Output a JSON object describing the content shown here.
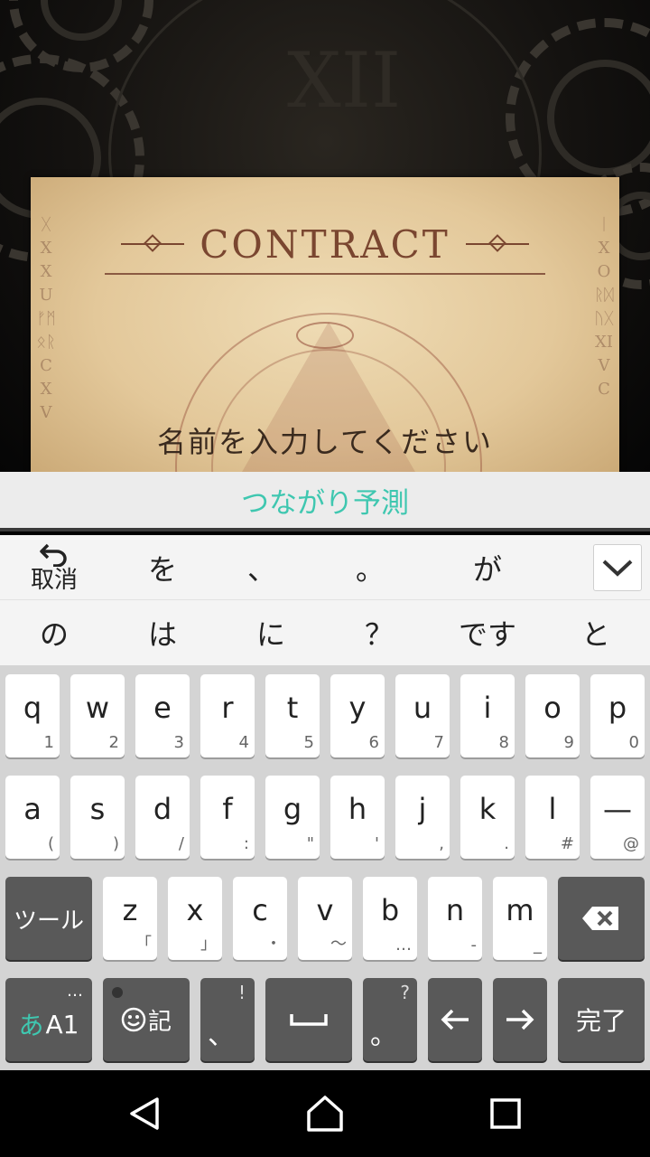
{
  "scene": {
    "numeral": "XII",
    "contract_title": "CONTRACT",
    "prompt": "名前を入力してください"
  },
  "prediction": {
    "label": "つながり予測"
  },
  "candidates": {
    "undo_label": "取消",
    "row1": [
      "を",
      "、",
      "。",
      "が"
    ],
    "row2": [
      "の",
      "は",
      "に",
      "？",
      "です",
      "と"
    ]
  },
  "keyboard": {
    "row1": [
      {
        "main": "q",
        "sub": "1"
      },
      {
        "main": "w",
        "sub": "2"
      },
      {
        "main": "e",
        "sub": "3"
      },
      {
        "main": "r",
        "sub": "4"
      },
      {
        "main": "t",
        "sub": "5"
      },
      {
        "main": "y",
        "sub": "6"
      },
      {
        "main": "u",
        "sub": "7"
      },
      {
        "main": "i",
        "sub": "8"
      },
      {
        "main": "o",
        "sub": "9"
      },
      {
        "main": "p",
        "sub": "0"
      }
    ],
    "row2": [
      {
        "main": "a",
        "sub": "("
      },
      {
        "main": "s",
        "sub": ")"
      },
      {
        "main": "d",
        "sub": "/"
      },
      {
        "main": "f",
        "sub": ":"
      },
      {
        "main": "g",
        "sub": "\""
      },
      {
        "main": "h",
        "sub": "'"
      },
      {
        "main": "j",
        "sub": ","
      },
      {
        "main": "k",
        "sub": "."
      },
      {
        "main": "l",
        "sub": "#"
      },
      {
        "main": "—",
        "sub": "@"
      }
    ],
    "row3": [
      {
        "main": "z",
        "sub": "「"
      },
      {
        "main": "x",
        "sub": "」"
      },
      {
        "main": "c",
        "sub": "・"
      },
      {
        "main": "v",
        "sub": "〜"
      },
      {
        "main": "b",
        "sub": "…"
      },
      {
        "main": "n",
        "sub": "-"
      },
      {
        "main": "m",
        "sub": "_"
      }
    ],
    "tool_label": "ツール",
    "mode_kana": "あ",
    "mode_alpha": "A1",
    "mode_dots": "…",
    "emoji_label": "記",
    "comma_main": "、",
    "comma_sub": "!",
    "period_main": "。",
    "period_sub": "?",
    "done_label": "完了"
  },
  "colors": {
    "accent": "#3fc7b0",
    "dark_key": "#595959",
    "keyboard_bg": "#d4d4d4",
    "paper": "#e6cfa3",
    "ink": "#7a4630"
  },
  "icons": {
    "undo": "undo-icon",
    "collapse": "chevron-down-icon",
    "backspace": "backspace-icon",
    "emoji": "smiley-icon",
    "space": "space-icon",
    "left": "arrow-left-icon",
    "right": "arrow-right-icon",
    "nav_back": "back-triangle-icon",
    "nav_home": "home-icon",
    "nav_recents": "recents-square-icon"
  }
}
